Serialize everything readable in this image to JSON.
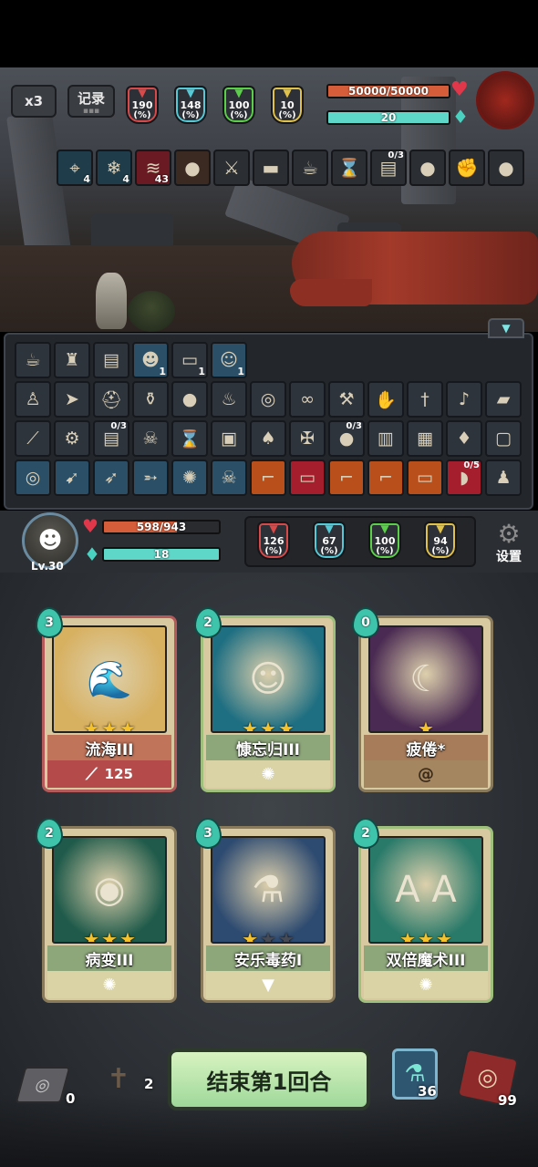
{
  "top_bar": {
    "speed_label": "x3",
    "log_label": "记录"
  },
  "enemy": {
    "stats": [
      {
        "value": "190",
        "unit": "(%)",
        "color": "#d84a4a",
        "icon": "sword-icon"
      },
      {
        "value": "148",
        "unit": "(%)",
        "color": "#55c9d6",
        "icon": "question-shield-icon"
      },
      {
        "value": "100",
        "unit": "(%)",
        "color": "#5ccf4a",
        "icon": "castle-icon"
      },
      {
        "value": "10",
        "unit": "(%)",
        "color": "#e0c24a",
        "icon": "crit-icon"
      }
    ],
    "hp_text": "50000/50000",
    "hp_fraction": 1.0,
    "energy_text": "20",
    "energy_fraction": 1.0,
    "buffs": [
      {
        "icon": "crosshair-icon",
        "glyph": "⌖",
        "count": "4",
        "top": "",
        "bg": "#1e3c4a"
      },
      {
        "icon": "snowflake-icon",
        "glyph": "❄",
        "count": "4",
        "top": "",
        "bg": "#1e3c4a"
      },
      {
        "icon": "claw-mark-icon",
        "glyph": "≋",
        "count": "43",
        "top": "",
        "bg": "#6a1a22"
      },
      {
        "icon": "fire-bomb-icon",
        "glyph": "●",
        "count": "",
        "top": "",
        "bg": "#3a2a22"
      },
      {
        "icon": "dagger-icon",
        "glyph": "⚔",
        "count": "",
        "top": "",
        "bg": "#2b2f33"
      },
      {
        "icon": "red-scroll-icon",
        "glyph": "▬",
        "count": "",
        "top": "",
        "bg": "#2b2f33"
      },
      {
        "icon": "teacup-icon",
        "glyph": "☕",
        "count": "",
        "top": "",
        "bg": "#2b2f33"
      },
      {
        "icon": "hourglass-icon",
        "glyph": "⌛",
        "count": "",
        "top": "",
        "bg": "#2b2f33"
      },
      {
        "icon": "spellbook-icon",
        "glyph": "▤",
        "count": "",
        "top": "0/3",
        "bg": "#2b2f33"
      },
      {
        "icon": "rock-orb-icon",
        "glyph": "●",
        "count": "",
        "top": "",
        "bg": "#2b2f33"
      },
      {
        "icon": "fist-icon",
        "glyph": "✊",
        "count": "",
        "top": "",
        "bg": "#2b2f33"
      },
      {
        "icon": "apple-icon",
        "glyph": "●",
        "count": "",
        "top": "",
        "bg": "#2b2f33"
      }
    ]
  },
  "inventory": {
    "rows": [
      [
        {
          "icon": "teacup-icon",
          "glyph": "☕",
          "count": "",
          "top": "",
          "style": ""
        },
        {
          "icon": "wood-totem-icon",
          "glyph": "♜",
          "count": "",
          "top": "",
          "style": ""
        },
        {
          "icon": "spellbook-icon",
          "glyph": "▤",
          "count": "",
          "top": "",
          "style": ""
        },
        {
          "icon": "shadow-face-icon",
          "glyph": "☻",
          "count": "1",
          "top": "",
          "style": "blue"
        },
        {
          "icon": "paper-icon",
          "glyph": "▭",
          "count": "1",
          "top": "",
          "style": ""
        },
        {
          "icon": "ghost-face-icon",
          "glyph": "☺",
          "count": "1",
          "top": "",
          "style": "blue"
        }
      ],
      [
        {
          "icon": "voodoo-doll-icon",
          "glyph": "♙",
          "count": "",
          "top": "",
          "style": ""
        },
        {
          "icon": "fish-icon",
          "glyph": "➤",
          "count": "",
          "top": "",
          "style": ""
        },
        {
          "icon": "helmet-icon",
          "glyph": "⛑",
          "count": "",
          "top": "",
          "style": ""
        },
        {
          "icon": "green-jar-icon",
          "glyph": "⚱",
          "count": "",
          "top": "",
          "style": ""
        },
        {
          "icon": "fire-bomb-icon",
          "glyph": "●",
          "count": "",
          "top": "",
          "style": ""
        },
        {
          "icon": "torch-icon",
          "glyph": "♨",
          "count": "",
          "top": "",
          "style": ""
        },
        {
          "icon": "brain-jar-icon",
          "glyph": "◎",
          "count": "",
          "top": "",
          "style": ""
        },
        {
          "icon": "goggles-icon",
          "glyph": "∞",
          "count": "",
          "top": "",
          "style": ""
        },
        {
          "icon": "pickaxe-icon",
          "glyph": "⚒",
          "count": "",
          "top": "",
          "style": ""
        },
        {
          "icon": "glove-icon",
          "glyph": "✋",
          "count": "",
          "top": "",
          "style": ""
        },
        {
          "icon": "knife-icon",
          "glyph": "†",
          "count": "",
          "top": "",
          "style": ""
        },
        {
          "icon": "trumpet-icon",
          "glyph": "♪",
          "count": "",
          "top": "",
          "style": ""
        },
        {
          "icon": "bread-icon",
          "glyph": "▰",
          "count": "",
          "top": "",
          "style": ""
        }
      ],
      [
        {
          "icon": "green-vial-icon",
          "glyph": "⟋",
          "count": "",
          "top": "",
          "style": ""
        },
        {
          "icon": "gear-trap-icon",
          "glyph": "⚙",
          "count": "",
          "top": "",
          "style": ""
        },
        {
          "icon": "purple-book-icon",
          "glyph": "▤",
          "count": "",
          "top": "0/3",
          "style": ""
        },
        {
          "icon": "bone-hand-icon",
          "glyph": "☠",
          "count": "",
          "top": "",
          "style": ""
        },
        {
          "icon": "hourglass-icon",
          "glyph": "⌛",
          "count": "",
          "top": "",
          "style": ""
        },
        {
          "icon": "barrel-icon",
          "glyph": "▣",
          "count": "",
          "top": "",
          "style": ""
        },
        {
          "icon": "sack-icon",
          "glyph": "♠",
          "count": "",
          "top": "",
          "style": ""
        },
        {
          "icon": "crossbow-icon",
          "glyph": "✠",
          "count": "",
          "top": "",
          "style": ""
        },
        {
          "icon": "apple-icon",
          "glyph": "●",
          "count": "",
          "top": "0/3",
          "style": ""
        },
        {
          "icon": "red-tome-icon",
          "glyph": "▥",
          "count": "",
          "top": "",
          "style": ""
        },
        {
          "icon": "chest-icon",
          "glyph": "▦",
          "count": "",
          "top": "",
          "style": ""
        },
        {
          "icon": "lamp-icon",
          "glyph": "♦",
          "count": "",
          "top": "",
          "style": ""
        },
        {
          "icon": "black-frame-icon",
          "glyph": "▢",
          "count": "",
          "top": "",
          "style": ""
        }
      ],
      [
        {
          "icon": "swirl-skill-icon",
          "glyph": "◎",
          "count": "",
          "top": "",
          "style": "blue"
        },
        {
          "icon": "strike-skill-icon",
          "glyph": "➹",
          "count": "",
          "top": "",
          "style": "blue"
        },
        {
          "icon": "slash-skill-icon",
          "glyph": "➶",
          "count": "",
          "top": "",
          "style": "blue"
        },
        {
          "icon": "dash-skill-icon",
          "glyph": "➵",
          "count": "",
          "top": "",
          "style": "blue"
        },
        {
          "icon": "spin-skill-icon",
          "glyph": "✺",
          "count": "",
          "top": "",
          "style": "blue"
        },
        {
          "icon": "horned-skull-icon",
          "glyph": "☠",
          "count": "",
          "top": "",
          "style": "blue"
        },
        {
          "icon": "boot-icon",
          "glyph": "⌐",
          "count": "",
          "top": "",
          "style": "orange"
        },
        {
          "icon": "scroll-icon",
          "glyph": "▭",
          "count": "",
          "top": "",
          "style": "red"
        },
        {
          "icon": "boot-icon",
          "glyph": "⌐",
          "count": "",
          "top": "",
          "style": "orange"
        },
        {
          "icon": "boot-icon",
          "glyph": "⌐",
          "count": "",
          "top": "",
          "style": "orange"
        },
        {
          "icon": "open-scroll-icon",
          "glyph": "▭",
          "count": "",
          "top": "",
          "style": "orange"
        },
        {
          "icon": "meat-icon",
          "glyph": "◗",
          "count": "",
          "top": "0/5",
          "style": "red"
        },
        {
          "icon": "dark-figure-icon",
          "glyph": "♟",
          "count": "",
          "top": "",
          "style": ""
        }
      ]
    ]
  },
  "player": {
    "level": "Lv.30",
    "hp_text": "598/943",
    "hp_fraction": 0.634,
    "energy_text": "18",
    "energy_fraction": 1.0,
    "stats": [
      {
        "value": "126",
        "unit": "(%)",
        "color": "#d84a4a",
        "icon": "sword-icon"
      },
      {
        "value": "67",
        "unit": "(%)",
        "color": "#55c9d6",
        "icon": "question-shield-icon"
      },
      {
        "value": "100",
        "unit": "(%)",
        "color": "#5ccf4a",
        "icon": "castle-icon"
      },
      {
        "value": "94",
        "unit": "(%)",
        "color": "#e0c24a",
        "icon": "crit-icon"
      }
    ],
    "settings_label": "设置"
  },
  "cards": [
    {
      "name": "流海III",
      "cost": "3",
      "stars": 3,
      "max_stars": 3,
      "foot_value": "125",
      "foot_icon": "claw-icon",
      "art_bg": "#d7b060",
      "band_color": "#c0745a",
      "foot_color": "#b44a4a",
      "frame": "rare",
      "art_glyph": "🌊"
    },
    {
      "name": "慷忘归III",
      "cost": "2",
      "stars": 3,
      "max_stars": 3,
      "foot_value": "",
      "foot_icon": "whistle-icon",
      "art_bg": "#1f6f82",
      "band_color": "#8da67a",
      "foot_color": "#d9d3a6",
      "frame": "green",
      "art_glyph": "☺"
    },
    {
      "name": "疲倦*",
      "cost": "0",
      "stars": 1,
      "max_stars": 1,
      "foot_value": "",
      "foot_icon": "spiral-icon",
      "art_bg": "#4a2a52",
      "band_color": "#a77c5a",
      "foot_color": "#a48660",
      "frame": "",
      "art_glyph": "☾"
    },
    {
      "name": "病变III",
      "cost": "2",
      "stars": 3,
      "max_stars": 3,
      "foot_value": "",
      "foot_icon": "whistle-icon",
      "art_bg": "#1f5a4a",
      "band_color": "#8da67a",
      "foot_color": "#d9d3a6",
      "frame": "",
      "art_glyph": "◉"
    },
    {
      "name": "安乐毒药I",
      "cost": "3",
      "stars": 1,
      "max_stars": 3,
      "foot_value": "",
      "foot_icon": "down-arrow-icon",
      "art_bg": "#2d4a70",
      "band_color": "#8da67a",
      "foot_color": "#d9d3a6",
      "frame": "",
      "art_glyph": "⚗"
    },
    {
      "name": "双倍魔术III",
      "cost": "2",
      "stars": 3,
      "max_stars": 3,
      "foot_value": "",
      "foot_icon": "whistle-icon",
      "art_bg": "#2a7a6a",
      "band_color": "#8da67a",
      "foot_color": "#d9d3a6",
      "frame": "green",
      "art_glyph": "A A"
    }
  ],
  "bottom": {
    "discard_count": "0",
    "grave_count": "2",
    "end_turn_label": "结束第1回合",
    "potion_count": "36",
    "deck_count": "99"
  }
}
